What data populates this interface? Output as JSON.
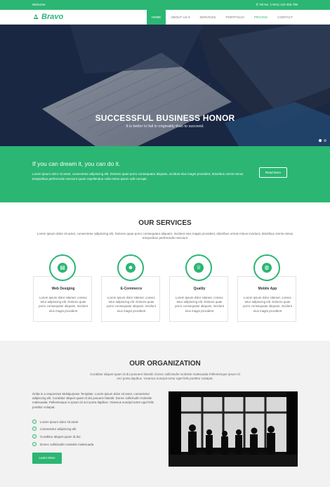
{
  "topbar": {
    "welcome": "Welcome",
    "phone": "Tel No. (+001) 123 456 789"
  },
  "nav": {
    "logo": "Bravo",
    "items": [
      {
        "label": "HOME"
      },
      {
        "label": "ABOUT US ▾"
      },
      {
        "label": "SERVICES"
      },
      {
        "label": "PORTFOLIO"
      },
      {
        "label": "PRICING"
      },
      {
        "label": "CONTACT"
      }
    ]
  },
  "hero": {
    "title": "SUCCESSFUL BUSINESS HONOR",
    "subtitle": "It is better to fail in originality than to succeed.",
    "active_slide": 1,
    "slide_count": 2
  },
  "band": {
    "heading": "If you can dream it, you can do it.",
    "text": "Lorem ipsum dolor sit amet, consectetur adipiscing elit. Dolores quae porro consequatur aliquam, incidunt eius magni provident, doloribus omnis minus temporibus perferendis nesciunt quam repellendus nulla nemo ipsum odit corrupti.",
    "button": "Read More"
  },
  "services": {
    "title": "OUR SERVICES",
    "desc": "Lorem ipsum dolor sit amet, consectetur adipiscing elit. Dolores quae porro consequatur aliquam, incidunt eius magni provident, doloribus omnis minus incidunt, doloribus omnis minus temporibus perferendis nesciunt",
    "cards": [
      {
        "title": "Web Desiging",
        "icon": "book-icon",
        "text": "Lorem ipsum dolor sitamet, consec tetur adipiscing elit. Dolores quae porro consequatur aliquam, incidunt eius magni provident"
      },
      {
        "title": "E-Commerce",
        "icon": "users-icon",
        "text": "Lorem ipsum dolor sitamet, consec tetur adipiscing elit. Dolores quae porro consequatur aliquam, incidunt eius magni provident"
      },
      {
        "title": "Quality",
        "icon": "trophy-icon",
        "text": "Lorem ipsum dolor sitamet, consec tetur adipiscing elit. Dolores quae porro consequatur aliquam, incidunt eius magni provident"
      },
      {
        "title": "Mobile App",
        "icon": "globe-icon",
        "text": "Lorem ipsum dolor sitamet, consec tetur adipiscing elit. Dolores quae porro consequatur aliquam, incidunt eius magni provident"
      }
    ]
  },
  "organization": {
    "title": "OUR ORGANIZATION",
    "desc": "Curabitur aliquet quam id dui posuere blandit. Donec sollicitudin molestie malesuada Pellentesque ipsum id orci porta dapibus. Vivamus suscipit tortor eget felis porttitor volutpat.",
    "text": "Grida is a responsive Multipurpose Template. Lorem ipsum dolor sit amet, consectetur adipiscing elit. Curabitur aliquet quam id dui posuere blandit. Donec sollicitudin molestie malesuada. Pellentesque in ipsum id orci porta dapibus. Vivamus suscipit tortor eget felis porttitor volutpat.",
    "list": [
      "Lorem ipsum dolor sit amet",
      "consectetur adipiscing elit",
      "Curabitur aliquet quam id dui",
      "Donec sollicitudin molestie malesuada"
    ],
    "button": "Learn More"
  },
  "colors": {
    "accent": "#2bb673",
    "hero_dark": "#1b2a47",
    "section_gray": "#f2f2f2"
  }
}
